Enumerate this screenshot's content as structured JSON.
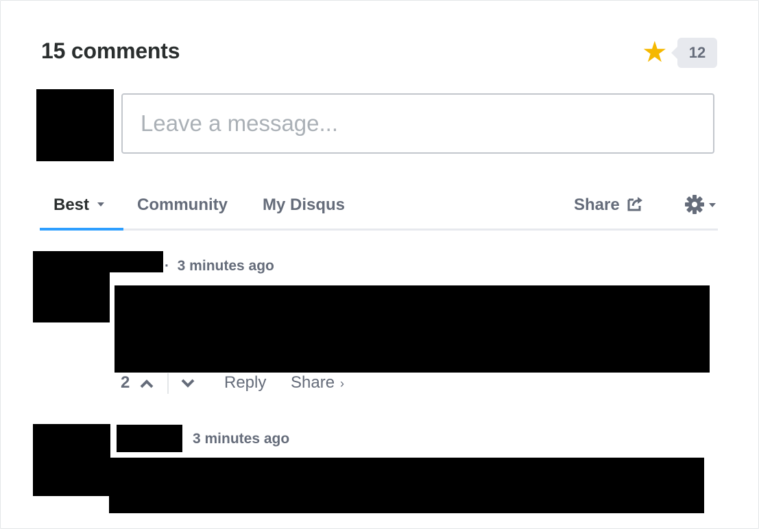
{
  "header": {
    "comment_count_label": "15 comments",
    "star_count": "12"
  },
  "composer": {
    "placeholder": "Leave a message..."
  },
  "tabs": {
    "best_label": "Best",
    "community_label": "Community",
    "my_disqus_label": "My Disqus",
    "share_label": "Share"
  },
  "comments": [
    {
      "timestamp": "3 minutes ago",
      "meta_separator": "·",
      "votes": "2",
      "reply_label": "Reply",
      "share_label": "Share",
      "share_chevron": "›"
    },
    {
      "timestamp": "3 minutes ago"
    }
  ],
  "colors": {
    "accent": "#2e9fff",
    "star": "#f5b800",
    "muted_text": "#656c7a"
  }
}
